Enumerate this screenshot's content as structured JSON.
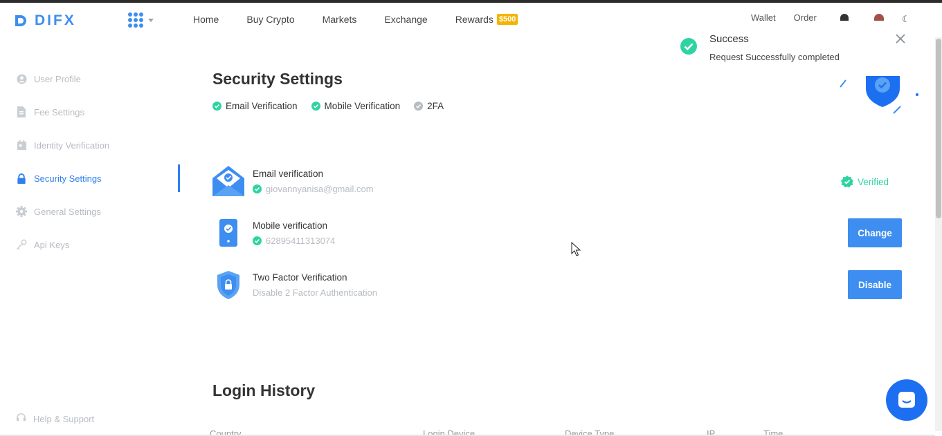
{
  "header": {
    "logo_text": "DIFX",
    "nav": [
      "Home",
      "Buy Crypto",
      "Markets",
      "Exchange",
      "Rewards"
    ],
    "rewards_badge": "$500",
    "right_nav": [
      "Wallet",
      "Order"
    ]
  },
  "toast": {
    "title": "Success",
    "message": "Request Successfully completed"
  },
  "sidebar": {
    "items": [
      {
        "label": "User Profile",
        "icon": "user-icon"
      },
      {
        "label": "Fee Settings",
        "icon": "document-icon"
      },
      {
        "label": "Identity Verification",
        "icon": "id-card-icon"
      },
      {
        "label": "Security Settings",
        "icon": "lock-icon",
        "active": true
      },
      {
        "label": "General Settings",
        "icon": "gear-icon"
      },
      {
        "label": "Api Keys",
        "icon": "key-icon"
      }
    ],
    "help": "Help & Support"
  },
  "main": {
    "title": "Security Settings",
    "status": [
      {
        "label": "Email Verification",
        "done": true
      },
      {
        "label": "Mobile Verification",
        "done": true
      },
      {
        "label": "2FA",
        "done": false
      }
    ],
    "verifications": [
      {
        "title": "Email verification",
        "value": "giovannyanisa@gmail.com",
        "action": "Verified"
      },
      {
        "title": "Mobile verification",
        "value": "62895411313074",
        "action": "Change"
      },
      {
        "title": "Two Factor Verification",
        "value": "Disable 2 Factor Authentication",
        "action": "Disable"
      }
    ],
    "login_history_title": "Login History",
    "login_columns": [
      "Country",
      "Login Device",
      "Device Type",
      "IP",
      "Time"
    ]
  },
  "colors": {
    "primary": "#3d8ef0",
    "success": "#2dd4a1",
    "muted": "#b7bcc2",
    "badge": "#f5b400"
  }
}
